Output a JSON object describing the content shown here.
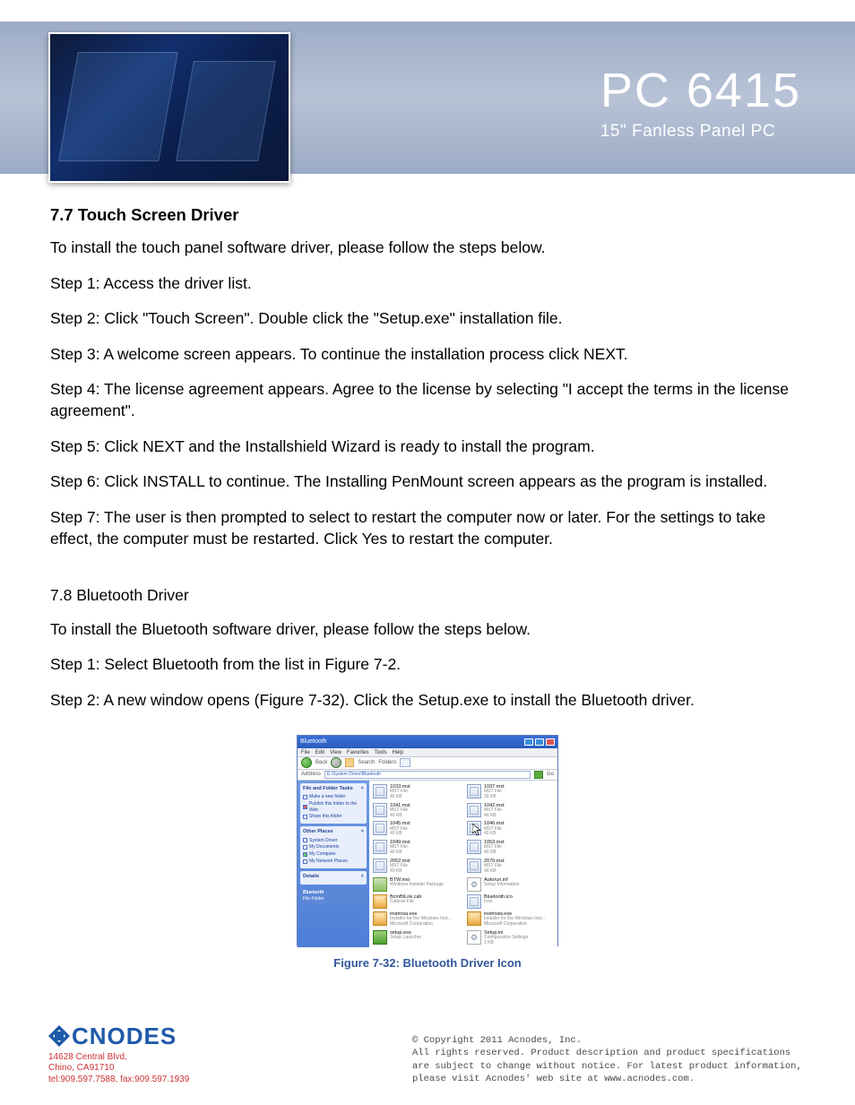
{
  "header": {
    "title": "PC 6415",
    "subtitle": "15\" Fanless Panel PC"
  },
  "section77": {
    "heading": "7.7 Touch Screen Driver",
    "intro": "To install the touch panel software driver, please follow the steps below.",
    "steps": [
      "Step 1:   Access the driver list.",
      "Step 2:   Click \"Touch Screen\".   Double click the \"Setup.exe\" installation file.",
      "Step 3:   A welcome screen appears. To continue the installation process click NEXT.",
      "Step 4:   The license agreement appears. Agree to the license by selecting \"I accept the terms in the license agreement\".",
      "Step 5:   Click NEXT and the Installshield Wizard is ready to install the program.",
      "Step 6:   Click INSTALL to continue. The Installing PenMount screen appears as the program is installed.",
      "Step 7:   The user is then prompted to select to restart the computer now or later.   For the settings to take effect, the computer must be restarted. Click Yes to restart the computer."
    ]
  },
  "section78": {
    "heading": "7.8 Bluetooth Driver",
    "intro": "To install the Bluetooth software driver, please follow the steps below.",
    "steps": [
      "Step 1:   Select Bluetooth from the list in Figure 7-2.",
      "Step 2:   A new window opens (Figure 7-32). Click the Setup.exe to install the Bluetooth driver."
    ]
  },
  "explorer": {
    "title": "Bluetooth",
    "menu": [
      "File",
      "Edit",
      "View",
      "Favorites",
      "Tools",
      "Help"
    ],
    "toolbar": {
      "back": "Back",
      "search": "Search",
      "folders": "Folders"
    },
    "address_label": "Address",
    "address_value": "E:\\System Driver\\Bluetooth",
    "go": "Go",
    "side_panels": {
      "tasks": {
        "title": "File and Folder Tasks",
        "items": [
          "Make a new folder",
          "Publish this folder to the Web",
          "Share this folder"
        ]
      },
      "places": {
        "title": "Other Places",
        "items": [
          "System Driver",
          "My Documents",
          "My Computer",
          "My Network Places"
        ]
      },
      "details": {
        "title": "Details"
      },
      "info": {
        "title": "Bluetooth",
        "sub": "File Folder"
      }
    },
    "files": [
      {
        "name": "1033.mst",
        "l1": "MST File",
        "l2": "40 KB",
        "icon": "small"
      },
      {
        "name": "1037.mst",
        "l1": "MST File",
        "l2": "39 KB",
        "icon": "small"
      },
      {
        "name": "1041.mst",
        "l1": "MST File",
        "l2": "40 KB",
        "icon": "small"
      },
      {
        "name": "1042.mst",
        "l1": "MST File",
        "l2": "40 KB",
        "icon": "small"
      },
      {
        "name": "1045.mst",
        "l1": "MST File",
        "l2": "40 KB",
        "icon": "small"
      },
      {
        "name": "1046.mst",
        "l1": "MST File",
        "l2": "40 KB",
        "icon": "small"
      },
      {
        "name": "1049.mst",
        "l1": "MST File",
        "l2": "40 KB",
        "icon": "small"
      },
      {
        "name": "1053.mst",
        "l1": "MST File",
        "l2": "40 KB",
        "icon": "small"
      },
      {
        "name": "2052.mst",
        "l1": "MST File",
        "l2": "40 KB",
        "icon": "small"
      },
      {
        "name": "2070.mst",
        "l1": "MST File",
        "l2": "40 KB",
        "icon": "small"
      },
      {
        "name": "BTW.msi",
        "l1": "Windows Installer Package",
        "l2": "",
        "icon": "msi"
      },
      {
        "name": "Autorun.inf",
        "l1": "Setup Information",
        "l2": "",
        "icon": "gear"
      },
      {
        "name": "BcmBtLnk.cab",
        "l1": "Cabinet File",
        "l2": "",
        "icon": "pkg"
      },
      {
        "name": "Bluetooth.ico",
        "l1": "Icon",
        "l2": "",
        "icon": "small"
      },
      {
        "name": "instmsia.exe",
        "l1": "Installer for the Windows Inst...",
        "l2": "Microsoft Corporation",
        "icon": "pkg"
      },
      {
        "name": "instmsiw.exe",
        "l1": "Installer for the Windows Inst...",
        "l2": "Microsoft Corporation",
        "icon": "pkg"
      },
      {
        "name": "setup.exe",
        "l1": "Setup Launcher",
        "l2": "",
        "icon": "exe"
      },
      {
        "name": "Setup.ini",
        "l1": "Configuration Settings",
        "l2": "1 KB",
        "icon": "gear"
      }
    ]
  },
  "figure_caption": "Figure 7-32: Bluetooth Driver Icon",
  "footer": {
    "logo_text": "CNODES",
    "addr1": "14628 Central Blvd,",
    "addr2": "Chino, CA91710",
    "addr3": "tel:909.597.7588, fax:909.597.1939",
    "copyright": "© Copyright 2011 Acnodes, Inc.\nAll rights reserved. Product description and product specifications are subject to change without notice. For latest product information, please visit Acnodes' web site at www.acnodes.com."
  }
}
